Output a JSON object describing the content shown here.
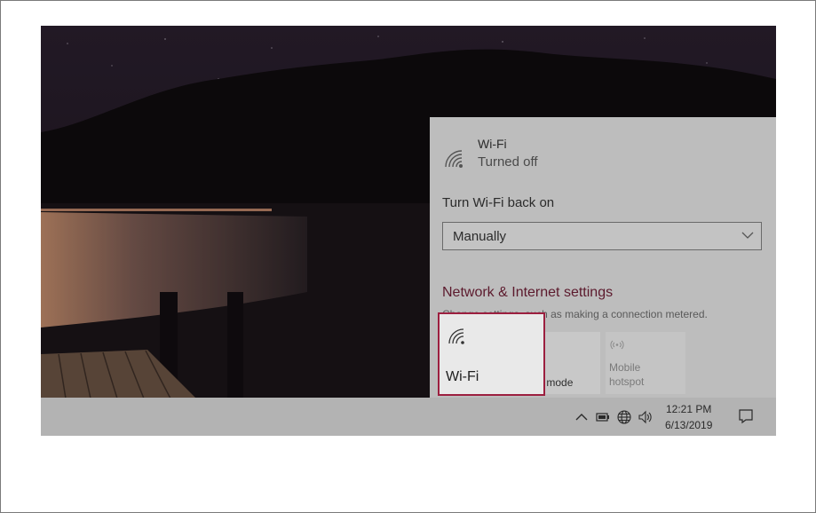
{
  "wifi": {
    "title": "Wi-Fi",
    "status": "Turned off",
    "turn_back_on_label": "Turn Wi-Fi back on",
    "turn_back_on_value": "Manually"
  },
  "network": {
    "link": "Network & Internet settings",
    "description": "Change settings, such as making a connection metered."
  },
  "quick_actions": {
    "wifi_label": "Wi-Fi",
    "airplane_label": "Airplane mode",
    "airplane_visible_label": "ane mode",
    "hotspot_label": "Mobile hotspot"
  },
  "taskbar": {
    "time": "12:21 PM",
    "date": "6/13/2019"
  },
  "icons": {
    "wifi": "wifi-icon",
    "hotspot": "hotspot-icon",
    "chevron": "chevron-down-icon",
    "tray_up": "chevron-up-icon",
    "battery": "battery-icon",
    "globe": "globe-icon",
    "volume": "volume-icon",
    "action_center": "action-center-icon"
  },
  "colors": {
    "highlight_border": "#9c1f3f",
    "link": "#5c1a2d",
    "flyout_bg": "#bdbdbd"
  }
}
